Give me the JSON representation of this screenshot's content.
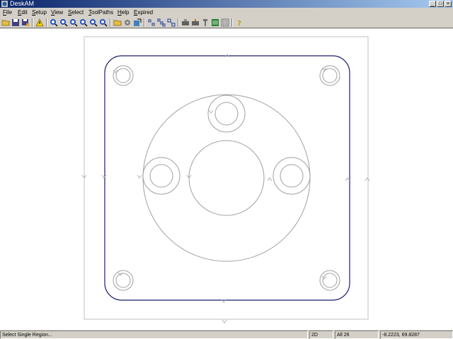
{
  "window": {
    "title": "DeskAM"
  },
  "menu": {
    "file": "File",
    "edit": "Edit",
    "setup": "Setup",
    "view": "View",
    "select": "Select",
    "toolpaths": "ToolPaths",
    "help": "Help",
    "expired": "Expired"
  },
  "toolbar": {
    "icons": [
      "open-folder-icon",
      "save-icon",
      "save-as-icon",
      "print-icon",
      "warning-icon",
      "zoom-in-icon",
      "zoom-out-icon",
      "zoom-window-icon",
      "zoom-extents-icon",
      "zoom-previous-icon",
      "pan-icon",
      "folder-icon",
      "settings-icon",
      "export-icon",
      "select-single-icon",
      "select-chain-icon",
      "select-region-icon",
      "machine-icon",
      "tool-icon",
      "probe-icon",
      "layers-icon",
      "grid-icon",
      "help-icon"
    ]
  },
  "status": {
    "message": "Select Single Region...",
    "mode": "2D",
    "selection": "All 26",
    "coordinates": "-8.2223, 69.8287"
  },
  "colors": {
    "titlebar_start": "#0a246a",
    "titlebar_end": "#a6caf0",
    "outline": "#1a1a6e",
    "construction": "#a0a0a0",
    "stock": "#c0c0c0"
  }
}
